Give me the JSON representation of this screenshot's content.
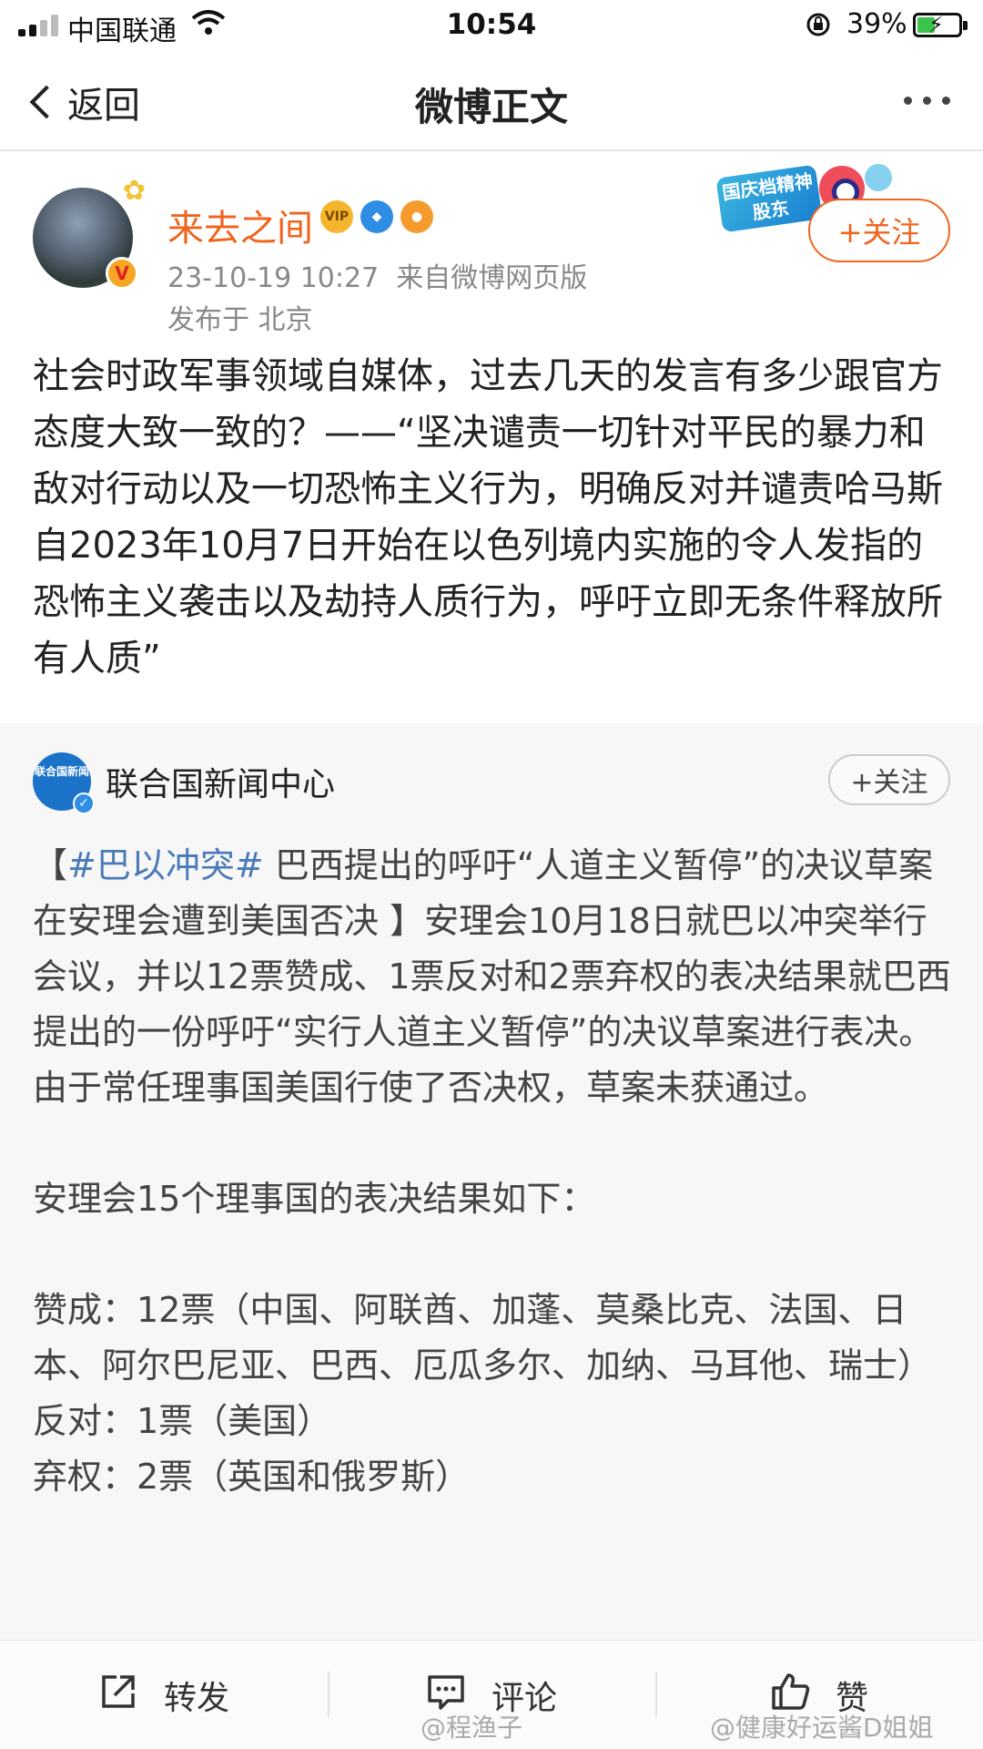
{
  "status_bar": {
    "carrier": "中国联通",
    "time": "10:54",
    "battery": "39%",
    "battery_level": 0.39
  },
  "nav": {
    "back_label": "返回",
    "title": "微博正文"
  },
  "post": {
    "author": "来去之间",
    "timestamp": "23-10-19 10:27",
    "source": "来自微博网页版",
    "location": "发布于 北京",
    "follow_label": "+关注",
    "promo_label": "国庆档精神股东",
    "badges": [
      "vip-badge",
      "shield-badge",
      "fish-badge"
    ],
    "text": "社会时政军事领域自媒体，过去几天的发言有多少跟官方态度大致一致的？——“坚决谴责一切针对平民的暴力和敌对行动以及一切恐怖主义行为，明确反对并谴责哈马斯自2023年10月7日开始在以色列境内实施的令人发指的恐怖主义袭击以及劫持人质行为，呼吁立即无条件释放所有人质”"
  },
  "repost": {
    "author": "联合国新闻中心",
    "avatar_text": "联合国新闻",
    "follow_label": "+关注",
    "bracket_open": "【",
    "hashtag": "#巴以冲突#",
    "headline": " 巴西提出的呼吁“人道主义暂停”的决议草案在安理会遭到美国否决 】",
    "body": "安理会10月18日就巴以冲突举行会议，并以12票赞成、1票反对和2票弃权的表决结果就巴西提出的一份呼吁“实行人道主义暂停”的决议草案进行表决。由于常任理事国美国行使了否决权，草案未获通过。",
    "intro": "安理会15个理事国的表决结果如下：",
    "votes_for": "赞成：12票（中国、阿联酋、加蓬、莫桑比克、法国、日本、阿尔巴尼亚、巴西、厄瓜多尔、加纳、马耳他、瑞士）",
    "votes_against": "反对：1票（美国）",
    "votes_abstain": "弃权：2票（英国和俄罗斯）"
  },
  "toolbar": {
    "repost_label": "转发",
    "comment_label": "评论",
    "like_label": "赞"
  },
  "watermarks": [
    "@程渔子",
    "@健康好运酱D姐姐"
  ],
  "colors": {
    "accent_orange": "#f0641e",
    "link_blue": "#4a7ab8",
    "repost_bg": "#f7f7f7"
  }
}
